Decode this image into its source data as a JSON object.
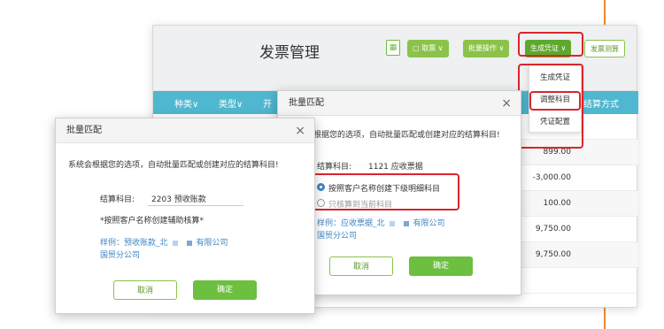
{
  "back_window": {
    "title": "发票管理",
    "toolbar": {
      "icon_glyph": "▦",
      "btn_1": "▢ 取票 ∨",
      "btn_2": "批量操作 ∨",
      "btn_3": "生成凭证 ∨",
      "btn_4": "发票测算"
    },
    "table": {
      "headers": [
        "种类∨",
        "类型∨",
        "开",
        "结算方式"
      ],
      "amounts": [
        "899.00",
        "-3,000.00",
        "100.00",
        "9,750.00",
        "9,750.00",
        ""
      ]
    },
    "dropdown": [
      "生成凭证",
      "调整科目",
      "凭证配置"
    ]
  },
  "dialog_middle": {
    "title": "批量匹配",
    "close": "×",
    "desc": "根据您的选项，自动批量匹配或创建对应的结算科目!",
    "subject_label": "结算科目:",
    "subject_value": "1121 应收票据",
    "option_1": "按照客户名称创建下级明细科目",
    "option_2": "只核算到当前科目",
    "example_prefix": "样例：应收票据_北",
    "example_suffix": "有限公司",
    "example_line2": "国贸分公司",
    "cancel": "取消",
    "ok": "确定"
  },
  "dialog_front": {
    "title": "批量匹配",
    "close": "×",
    "desc": "系统会根据您的选项，自动批量匹配或创建对应的结算科目!",
    "subject_label": "结算科目:",
    "subject_value": "2203 预收账款",
    "note": "*按照客户名称创建辅助核算*",
    "example_prefix": "样例：预收账款_北",
    "example_suffix": "有限公司",
    "example_line2": "国贸分公司",
    "cancel": "取消",
    "ok": "确定"
  },
  "colors": {
    "accent_orange": "#f08a2c",
    "green": "#6cbf3f",
    "table_header": "#4fb7cf",
    "highlight_red": "#d9262b",
    "link_blue": "#3f86c4"
  }
}
